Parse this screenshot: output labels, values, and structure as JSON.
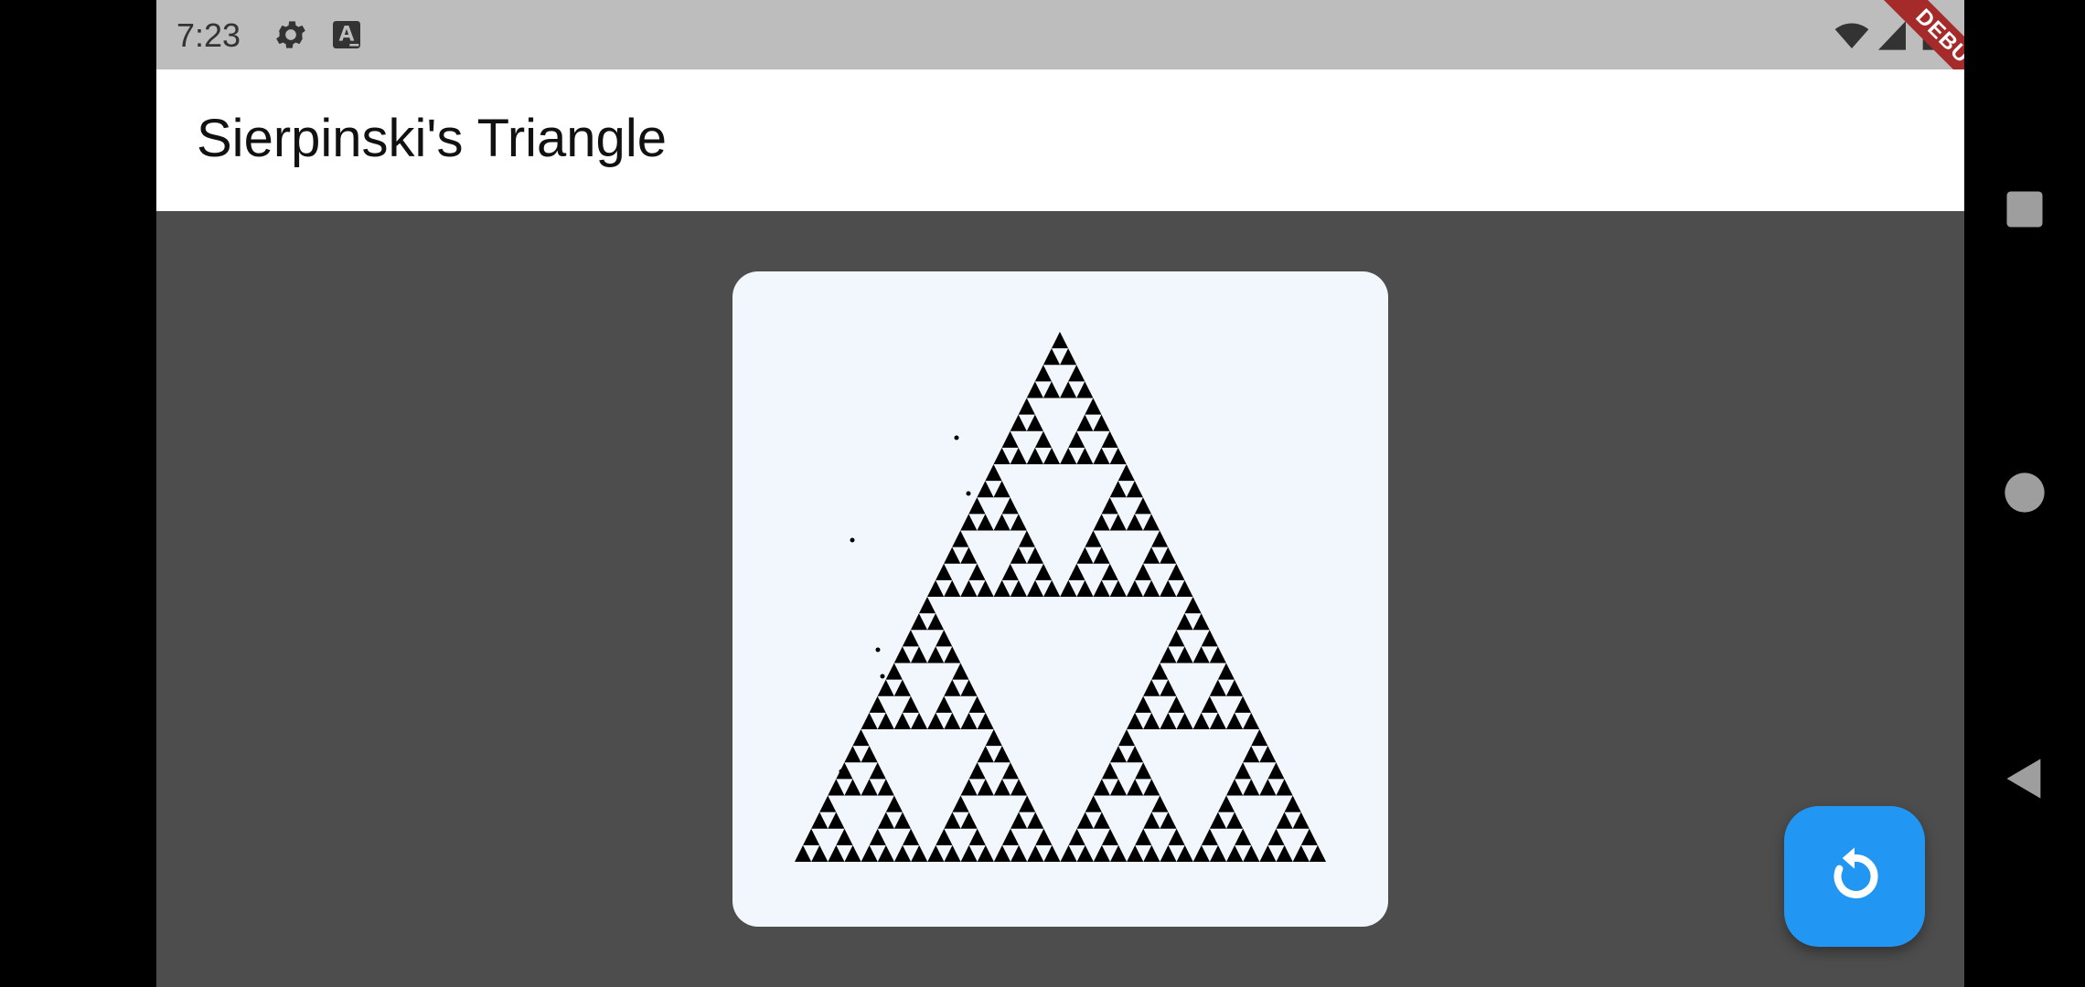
{
  "status_bar": {
    "time": "7:23",
    "icons": [
      "gear-icon",
      "keyboard-a-icon",
      "wifi-icon",
      "signal-icon",
      "battery-icon"
    ]
  },
  "app_bar": {
    "title": "Sierpinski's Triangle"
  },
  "debug_banner": {
    "label": "DEBUG"
  },
  "fab": {
    "icon": "refresh-icon",
    "color": "#2196f3"
  },
  "card": {
    "background": "#f2f7fd"
  },
  "nav_bar": {
    "buttons": [
      "recents-square-icon",
      "home-circle-icon",
      "back-triangle-icon"
    ]
  }
}
